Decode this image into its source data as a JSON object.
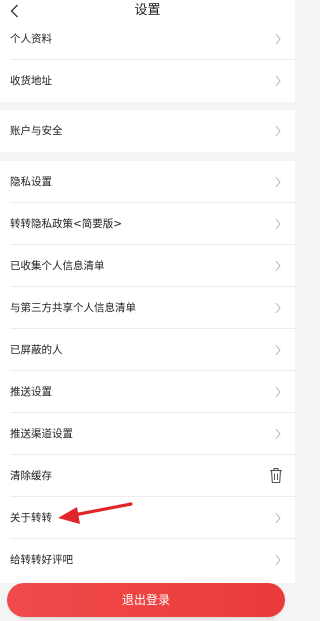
{
  "header": {
    "title": "设置"
  },
  "groups": [
    {
      "items": [
        {
          "label": "个人资料"
        },
        {
          "label": "收货地址"
        }
      ]
    },
    {
      "items": [
        {
          "label": "账户与安全"
        }
      ]
    },
    {
      "items": [
        {
          "label": "隐私设置"
        },
        {
          "label": "转转隐私政策<简要版>"
        },
        {
          "label": "已收集个人信息清单"
        },
        {
          "label": "与第三方共享个人信息清单"
        },
        {
          "label": "已屏蔽的人"
        },
        {
          "label": "推送设置"
        },
        {
          "label": "推送渠道设置"
        },
        {
          "label": "清除缓存",
          "trailing": "trash-icon"
        },
        {
          "label": "关于转转"
        },
        {
          "label": "给转转好评吧"
        }
      ]
    }
  ],
  "logout": {
    "label": "退出登录"
  },
  "colors": {
    "accent": "#ea3b3b",
    "arrow": "#e0262a",
    "background": "#f4f4f4"
  }
}
